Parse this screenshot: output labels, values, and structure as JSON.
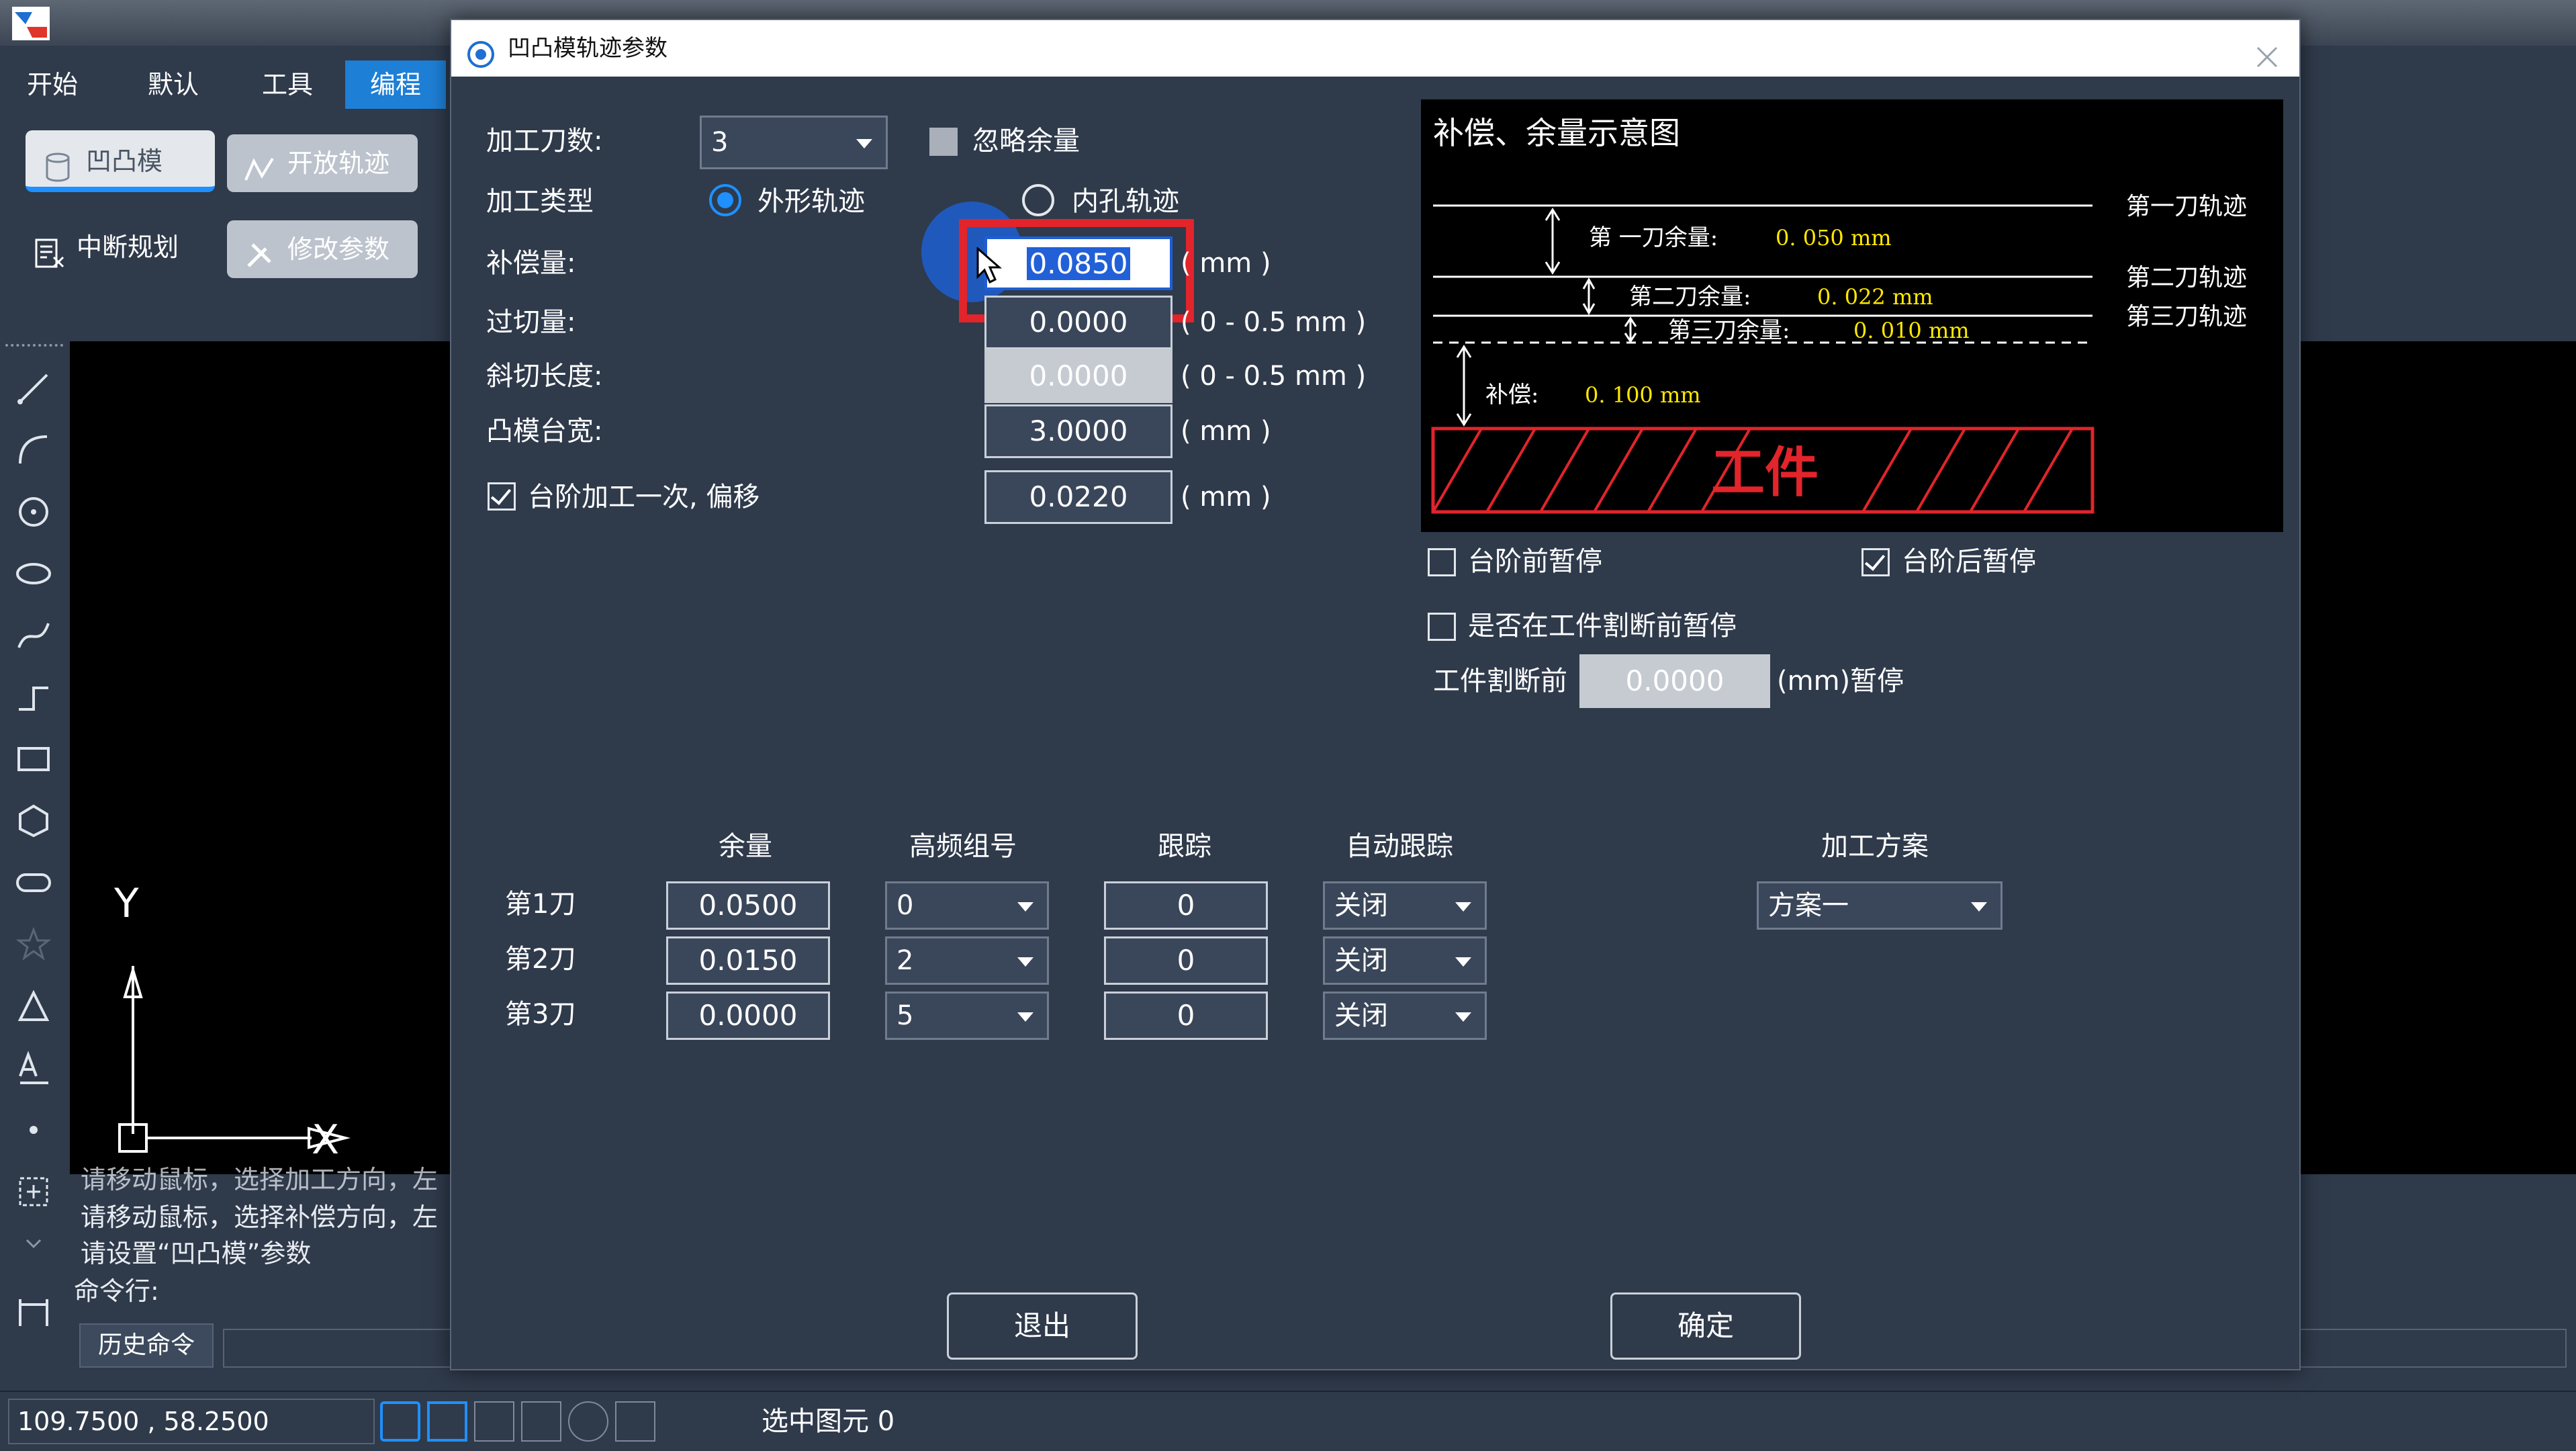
{
  "app": {
    "menus": [
      "开始",
      "默认",
      "工具",
      "编程"
    ],
    "active_menu": "编程",
    "ribbon": {
      "row1": [
        "凹凸模",
        "开放轨迹"
      ],
      "row2": [
        "中断规划",
        "修改参数"
      ]
    },
    "canvas_axes": {
      "y": "Y",
      "x": "X"
    },
    "log_lines": [
      "请移动鼠标，选择加工方向，左",
      "请移动鼠标，选择补偿方向，左",
      "请设置“凹凸模”参数"
    ],
    "command_label": "命令行:",
    "history_button": "历史命令",
    "status": {
      "coords": "109.7500 , 58.2500",
      "selected": "选中图元 0"
    }
  },
  "dialog": {
    "title": "凹凸模轨迹参数",
    "cut_count": {
      "label": "加工刀数:",
      "value": "3"
    },
    "ignore_allowance": {
      "label": "忽略余量",
      "checked": false
    },
    "process_type": {
      "label": "加工类型",
      "outer": "外形轨迹",
      "inner": "内孔轨迹",
      "selected": "外形轨迹"
    },
    "compensation": {
      "label": "补偿量:",
      "value": "0.0850",
      "unit": "( mm )"
    },
    "overcut": {
      "label": "过切量:",
      "value": "0.0000",
      "unit": "( 0 - 0.5 mm )"
    },
    "bevel_length": {
      "label": "斜切长度:",
      "value": "0.0000",
      "unit": "( 0 - 0.5 mm )"
    },
    "punch_step_width": {
      "label": "凸模台宽:",
      "value": "3.0000",
      "unit": "( mm )"
    },
    "step_once": {
      "label": "台阶加工一次, 偏移",
      "checked": true,
      "value": "0.0220",
      "unit": "( mm )"
    },
    "diagram": {
      "title": "补偿、余量示意图",
      "track1": "第一刀轨迹",
      "track2": "第二刀轨迹",
      "track3": "第三刀轨迹",
      "allow1_label": "第  一刀余量:",
      "allow1_value": "0. 050  mm",
      "allow2_label": "第二刀余量:",
      "allow2_value": "0. 022  mm",
      "allow3_label": "第三刀余量:",
      "allow3_value": "0. 010  mm",
      "comp_label": "补偿:",
      "comp_value": "0. 100  mm",
      "workpiece": "工件"
    },
    "pause_before_step": {
      "label": "台阶前暂停",
      "checked": false
    },
    "pause_after_step": {
      "label": "台阶后暂停",
      "checked": true
    },
    "pause_before_cut": {
      "label": "是否在工件割断前暂停",
      "checked": false
    },
    "cut_off": {
      "label": "工件割断前",
      "value": "0.0000",
      "suffix": "(mm)暂停"
    },
    "table": {
      "headers": [
        "余量",
        "高频组号",
        "跟踪",
        "自动跟踪"
      ],
      "rows": [
        {
          "label": "第1刀",
          "allowance": "0.0500",
          "group": "0",
          "track": "0",
          "auto": "关闭"
        },
        {
          "label": "第2刀",
          "allowance": "0.0150",
          "group": "2",
          "track": "0",
          "auto": "关闭"
        },
        {
          "label": "第3刀",
          "allowance": "0.0000",
          "group": "5",
          "track": "0",
          "auto": "关闭"
        }
      ]
    },
    "plan": {
      "label": "加工方案",
      "value": "方案一"
    },
    "exit_button": "退出",
    "ok_button": "确定"
  }
}
